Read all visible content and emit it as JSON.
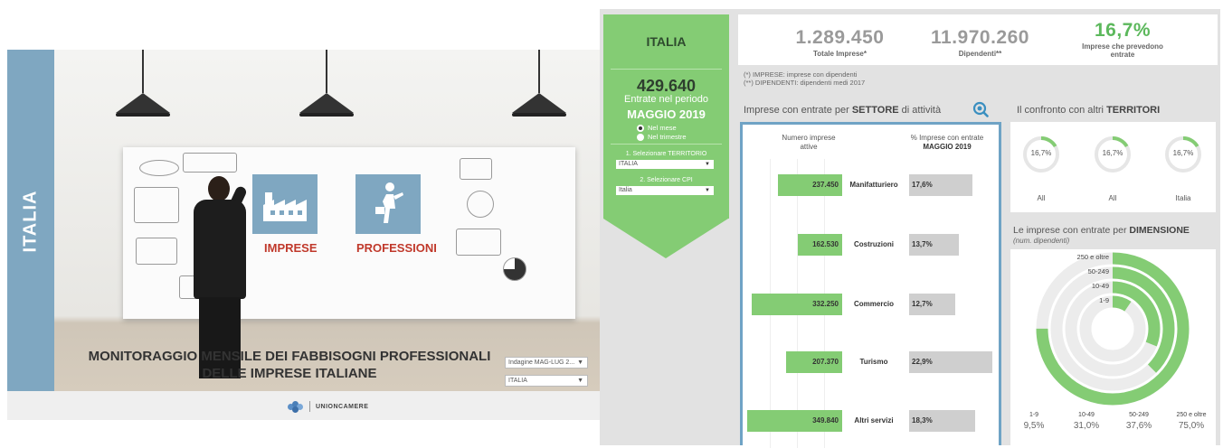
{
  "slide": {
    "side_label": "ITALIA",
    "tiles": [
      {
        "label": "IMPRESE",
        "icon": "factory-icon"
      },
      {
        "label": "PROFESSIONI",
        "icon": "professional-walking-icon"
      }
    ],
    "title_line1": "MONITORAGGIO MENSILE DEI FABBISOGNI PROFESSIONALI",
    "title_line2": "DELLE IMPRESE ITALIANE",
    "survey_select": "Indagine MAG-LUG 2...",
    "territory_select": "ITALIA",
    "logo_text": "UNIONCAMERE"
  },
  "region": {
    "title": "ITALIA",
    "entrate_value": "429.640",
    "entrate_label": "Entrate nel periodo",
    "period": "MAGGIO 2019",
    "radio_month": "Nel mese",
    "radio_quarter": "Nel trimestre",
    "label_territory": "1. Selezionare TERRITORIO",
    "territory_value": "ITALIA",
    "label_cpi": "2. Selezionare CPI",
    "cpi_value": "Italia"
  },
  "kpis": {
    "imprese_value": "1.289.450",
    "imprese_label": "Totale Imprese*",
    "dipendenti_value": "11.970.260",
    "dipendenti_label": "Dipendenti**",
    "pct_value": "16,7%",
    "pct_label_1": "Imprese che prevedono",
    "pct_label_2": "entrate"
  },
  "notes": {
    "line1": "(*) IMPRESE: imprese con dipendenti",
    "line2": "(**) DIPENDENTI: dipendenti medi 2017"
  },
  "sector": {
    "title_pre": "Imprese con entrate per ",
    "title_bold": "SETTORE",
    "title_post": " di attività",
    "col1_a": "Numero imprese",
    "col1_b": "attive",
    "col2_a": "% Imprese con entrate",
    "col2_b": "MAGGIO 2019",
    "rows": [
      {
        "name": "Manifatturiero",
        "value": "237.450",
        "pct": "17,6%"
      },
      {
        "name": "Costruzioni",
        "value": "162.530",
        "pct": "13,7%"
      },
      {
        "name": "Commercio",
        "value": "332.250",
        "pct": "12,7%"
      },
      {
        "name": "Turismo",
        "value": "207.370",
        "pct": "22,9%"
      },
      {
        "name": "Altri servizi",
        "value": "349.840",
        "pct": "18,3%"
      }
    ]
  },
  "territori": {
    "title_pre": "Il confronto con altri ",
    "title_bold": "TERRITORI",
    "donuts": [
      {
        "value": "16,7%",
        "label": "All",
        "fraction": 0.167
      },
      {
        "value": "16,7%",
        "label": "All",
        "fraction": 0.167
      },
      {
        "value": "16,7%",
        "label": "Italia",
        "fraction": 0.167
      }
    ]
  },
  "dimensione": {
    "title_pre": "Le imprese con entrate per ",
    "title_bold": "DIMENSIONE",
    "subtitle": "(num. dipendenti)",
    "rings": [
      {
        "label": "250 e oltre",
        "value": "75,0%",
        "fraction": 0.75
      },
      {
        "label": "50-249",
        "value": "37,6%",
        "fraction": 0.376
      },
      {
        "label": "10-49",
        "value": "31,0%",
        "fraction": 0.31
      },
      {
        "label": "1-9",
        "value": "9,5%",
        "fraction": 0.095
      }
    ],
    "footer": [
      {
        "label": "1-9",
        "value": "9,5%"
      },
      {
        "label": "10-49",
        "value": "31,0%"
      },
      {
        "label": "50-249",
        "value": "37,6%"
      },
      {
        "label": "250 e oltre",
        "value": "75,0%"
      }
    ]
  },
  "colors": {
    "green": "#84cc74",
    "blue": "#7fa7c1",
    "frame": "#6fa3c5",
    "gray_bar": "#cfcfcf",
    "red_label": "#c0392b"
  },
  "chart_data": [
    {
      "type": "bar",
      "title": "Imprese con entrate per SETTORE di attività",
      "categories": [
        "Manifatturiero",
        "Costruzioni",
        "Commercio",
        "Turismo",
        "Altri servizi"
      ],
      "series": [
        {
          "name": "Numero imprese attive",
          "values": [
            237450,
            162530,
            332250,
            207370,
            349840
          ]
        },
        {
          "name": "% Imprese con entrate MAGGIO 2019",
          "values": [
            17.6,
            13.7,
            12.7,
            22.9,
            18.3
          ]
        }
      ]
    },
    {
      "type": "pie",
      "title": "Le imprese con entrate per DIMENSIONE",
      "categories": [
        "1-9",
        "10-49",
        "50-249",
        "250 e oltre"
      ],
      "values": [
        9.5,
        31.0,
        37.6,
        75.0
      ]
    }
  ]
}
